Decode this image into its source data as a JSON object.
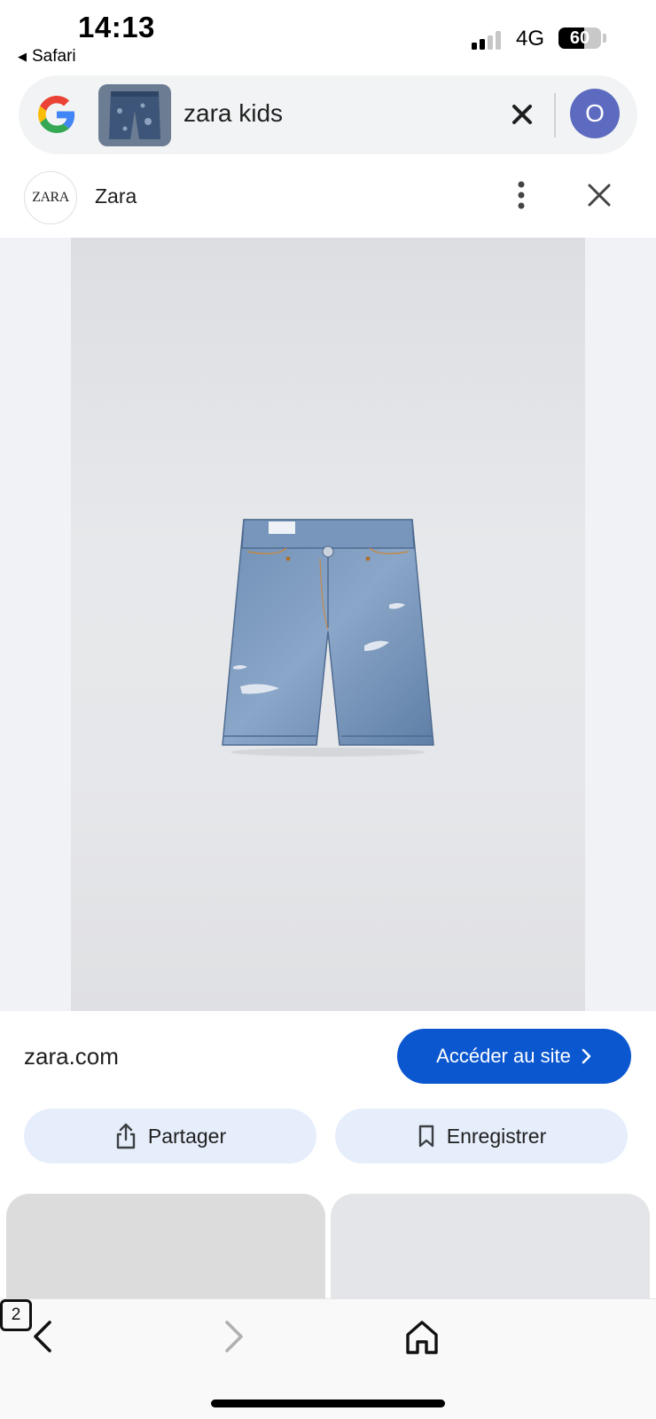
{
  "status_bar": {
    "time": "14:13",
    "back_app": "Safari",
    "network": "4G",
    "battery_percent": "60",
    "battery_level": 0.6,
    "signal_bars": 2
  },
  "search": {
    "query": "zara kids",
    "avatar_initial": "O"
  },
  "source": {
    "logo_text": "ZARA",
    "name": "Zara"
  },
  "result": {
    "domain": "zara.com",
    "visit_label": "Accéder au site"
  },
  "actions": {
    "share_label": "Partager",
    "save_label": "Enregistrer"
  },
  "toolbar": {
    "tabs_count": "2"
  },
  "colors": {
    "accent": "#0b57d0",
    "pill_bg": "#e6eefb",
    "avatar_bg": "#5c6bc0",
    "search_bg": "#f1f3f4"
  }
}
